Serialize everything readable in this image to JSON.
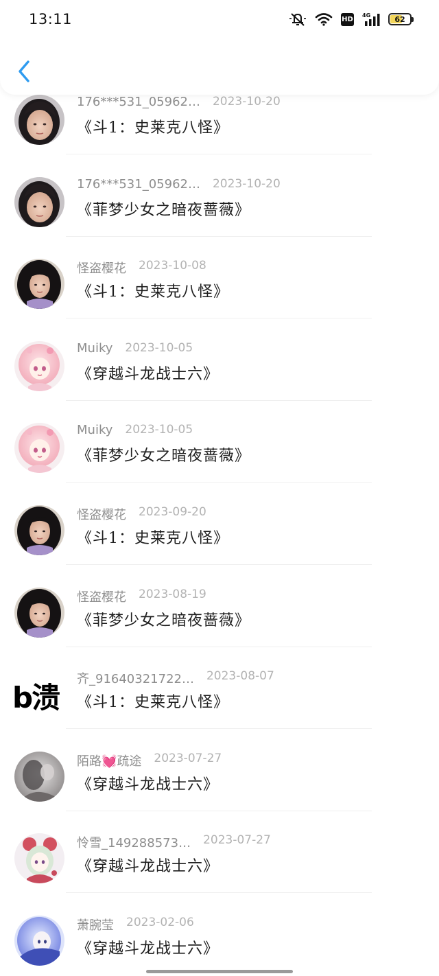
{
  "status_bar": {
    "time": "13:11",
    "network_label": "4G",
    "hd_label": "HD",
    "battery_level": "62",
    "battery_fraction": 0.62,
    "icons": [
      "mute-icon",
      "wifi-icon",
      "hd-icon",
      "signal-icon",
      "battery-icon"
    ]
  },
  "header": {
    "back_icon": "chevron-left-icon",
    "accent_color": "#2e9bf0"
  },
  "records": [
    {
      "name": "176***531_05962…",
      "date": "2023-10-20",
      "title": "《斗1：史莱克八怪》",
      "avatar": "photo-girl-1"
    },
    {
      "name": "176***531_05962…",
      "date": "2023-10-20",
      "title": "《菲梦少女之暗夜蔷薇》",
      "avatar": "photo-girl-1"
    },
    {
      "name": "怪盗樱花",
      "date": "2023-10-08",
      "title": "《斗1：史莱克八怪》",
      "avatar": "photo-girl-2"
    },
    {
      "name": "Muiky",
      "date": "2023-10-05",
      "title": "《穿越斗龙战士六》",
      "avatar": "anime-pink"
    },
    {
      "name": "Muiky",
      "date": "2023-10-05",
      "title": "《菲梦少女之暗夜蔷薇》",
      "avatar": "anime-pink"
    },
    {
      "name": "怪盗樱花",
      "date": "2023-09-20",
      "title": "《斗1：史莱克八怪》",
      "avatar": "photo-girl-2"
    },
    {
      "name": "怪盗樱花",
      "date": "2023-08-19",
      "title": "《菲梦少女之暗夜蔷薇》",
      "avatar": "photo-girl-2"
    },
    {
      "name": "齐_91640321722…",
      "date": "2023-08-07",
      "title": "《斗1：史莱克八怪》",
      "avatar": "text",
      "avatar_text": "b溃"
    },
    {
      "name": "陌路💓疏途",
      "date": "2023-07-27",
      "title": "《穿越斗龙战士六》",
      "avatar": "photo-gray"
    },
    {
      "name": "怜雪_149288573…",
      "date": "2023-07-27",
      "title": "《穿越斗龙战士六》",
      "avatar": "anime-red"
    },
    {
      "name": "萧腕莹",
      "date": "2023-02-06",
      "title": "《穿越斗龙战士六》",
      "avatar": "anime-blue"
    }
  ]
}
